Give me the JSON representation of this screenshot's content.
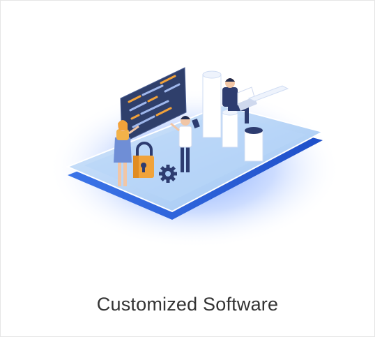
{
  "card": {
    "caption": "Customized Software"
  },
  "illustration": {
    "subject": "isometric phone platform with developers",
    "icons": [
      "code-screen-icon",
      "padlock-icon",
      "gear-icon",
      "server-pillar-icon",
      "laptop-icon"
    ],
    "colors": {
      "glow": "#7fa8ff",
      "platform_top": "#a9cdf7",
      "platform_edge": "#2b5fd9",
      "screen": "#2f3f6b",
      "code_accent": "#f2a23a",
      "lock": "#f0a33b",
      "gear": "#2d3c70",
      "pillar": "#ffffff"
    }
  }
}
